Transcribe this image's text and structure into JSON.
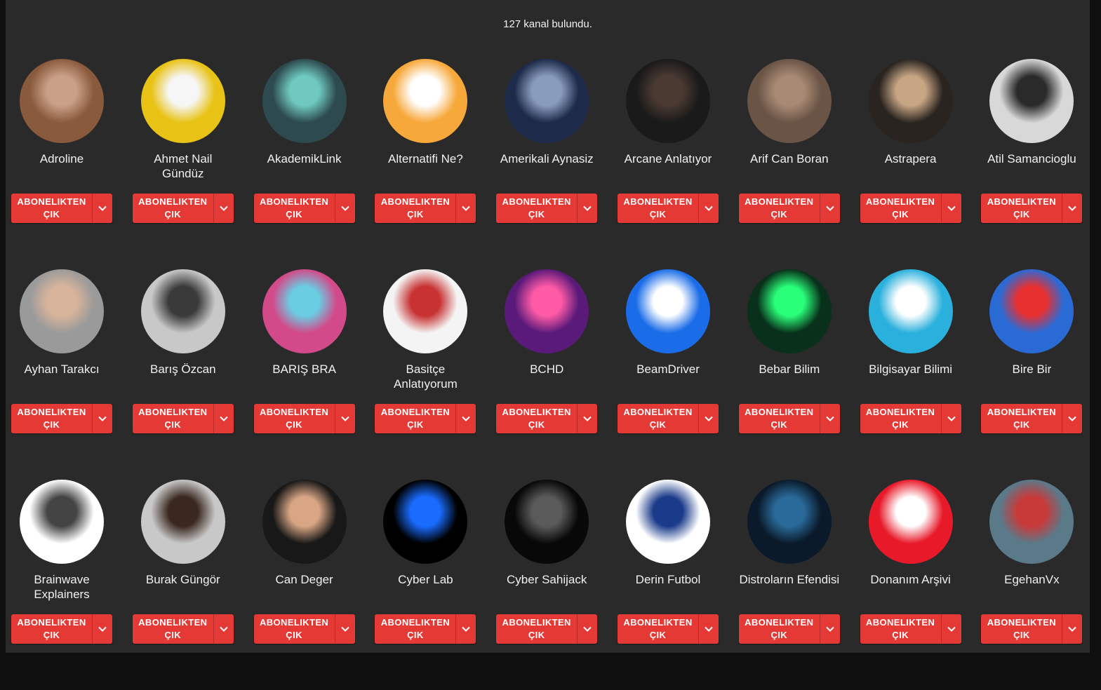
{
  "summary": {
    "count_text": "127 kanal bulundu."
  },
  "button": {
    "label": "ABONELIKTEN ÇIK",
    "menu_icon": "chevron-down-icon"
  },
  "channels": [
    {
      "name": "Adroline",
      "avatar": {
        "bg": "#8a5a3c",
        "fg": "#c9a088"
      }
    },
    {
      "name": "Ahmet Nail Gündüz",
      "avatar": {
        "bg": "#e8c214",
        "fg": "#f6f6f6"
      }
    },
    {
      "name": "AkademikLink",
      "avatar": {
        "bg": "#2d4a4e",
        "fg": "#6fc9c0"
      }
    },
    {
      "name": "Alternatifi Ne?",
      "avatar": {
        "bg": "#f7a83a",
        "fg": "#ffffff"
      }
    },
    {
      "name": "Amerikali Aynasiz",
      "avatar": {
        "bg": "#1d2a4a",
        "fg": "#8a9cbc"
      }
    },
    {
      "name": "Arcane Anlatıyor",
      "avatar": {
        "bg": "#1a1a1a",
        "fg": "#4a3a32"
      }
    },
    {
      "name": "Arif Can Boran",
      "avatar": {
        "bg": "#6a5446",
        "fg": "#a88a74"
      }
    },
    {
      "name": "Astrapera",
      "avatar": {
        "bg": "#2a2420",
        "fg": "#c7a684"
      }
    },
    {
      "name": "Atil Samancioglu",
      "avatar": {
        "bg": "#d8d8d8",
        "fg": "#2a2a2a"
      }
    },
    {
      "name": "Ayhan Tarakcı",
      "avatar": {
        "bg": "#9a9a9a",
        "fg": "#d8b49c"
      }
    },
    {
      "name": "Barış Özcan",
      "avatar": {
        "bg": "#c8c8c8",
        "fg": "#3a3a3a"
      }
    },
    {
      "name": "BARIŞ BRA",
      "avatar": {
        "bg": "#d24a8a",
        "fg": "#6acde2"
      }
    },
    {
      "name": "Basitçe Anlatıyorum",
      "avatar": {
        "bg": "#f4f4f4",
        "fg": "#c83232"
      }
    },
    {
      "name": "BCHD",
      "avatar": {
        "bg": "#5a1a7a",
        "fg": "#ff5aa6"
      }
    },
    {
      "name": "BeamDriver",
      "avatar": {
        "bg": "#1a6ce8",
        "fg": "#ffffff"
      }
    },
    {
      "name": "Bebar Bilim",
      "avatar": {
        "bg": "#08301a",
        "fg": "#2aff7a"
      }
    },
    {
      "name": "Bilgisayar Bilimi",
      "avatar": {
        "bg": "#2ab0dc",
        "fg": "#ffffff"
      }
    },
    {
      "name": "Bire Bir",
      "avatar": {
        "bg": "#2a6ad4",
        "fg": "#e83030"
      }
    },
    {
      "name": "Brainwave Explainers",
      "avatar": {
        "bg": "#ffffff",
        "fg": "#444444"
      }
    },
    {
      "name": "Burak Güngör",
      "avatar": {
        "bg": "#c8c8c8",
        "fg": "#3a2820"
      }
    },
    {
      "name": "Can Deger",
      "avatar": {
        "bg": "#181818",
        "fg": "#d8a684"
      }
    },
    {
      "name": "Cyber Lab",
      "avatar": {
        "bg": "#000000",
        "fg": "#1a6cff"
      }
    },
    {
      "name": "Cyber Sahijack",
      "avatar": {
        "bg": "#080808",
        "fg": "#5a5a5a"
      }
    },
    {
      "name": "Derin Futbol",
      "avatar": {
        "bg": "#ffffff",
        "fg": "#1a3a8a"
      }
    },
    {
      "name": "Distroların Efendisi",
      "avatar": {
        "bg": "#0a1a2a",
        "fg": "#2a6a9a"
      }
    },
    {
      "name": "Donanım Arşivi",
      "avatar": {
        "bg": "#e81a2a",
        "fg": "#ffffff"
      }
    },
    {
      "name": "EgehanVx",
      "avatar": {
        "bg": "#5a7a8a",
        "fg": "#c83a3a"
      }
    }
  ]
}
